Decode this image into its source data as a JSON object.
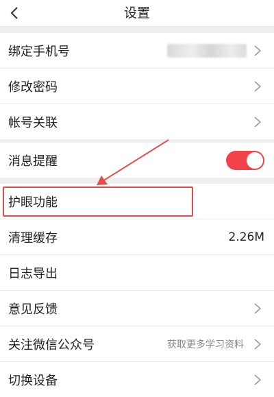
{
  "header": {
    "title": "设置",
    "back_icon": "chevron-left-icon"
  },
  "group_account": {
    "items": [
      {
        "label": "绑定手机号",
        "value": "",
        "blurred": true,
        "chevron": true
      },
      {
        "label": "修改密码",
        "chevron": true
      },
      {
        "label": "帐号关联",
        "chevron": true
      }
    ]
  },
  "group_settings": {
    "items": [
      {
        "label": "消息提醒",
        "toggle": true,
        "toggle_on": true
      }
    ]
  },
  "group_more": {
    "items": [
      {
        "label": "护眼功能"
      },
      {
        "label": "清理缓存",
        "value": "2.26M"
      },
      {
        "label": "日志导出"
      },
      {
        "label": "意见反馈",
        "chevron": true
      },
      {
        "label": "关注微信公众号",
        "hint": "获取更多学习资料",
        "chevron": true
      },
      {
        "label": "切换设备",
        "chevron": true
      }
    ]
  },
  "annotation": {
    "color": "#e84d4d",
    "target": "护眼功能"
  },
  "colors": {
    "toggle_on": "#f04248",
    "page_bg": "#efefef"
  }
}
